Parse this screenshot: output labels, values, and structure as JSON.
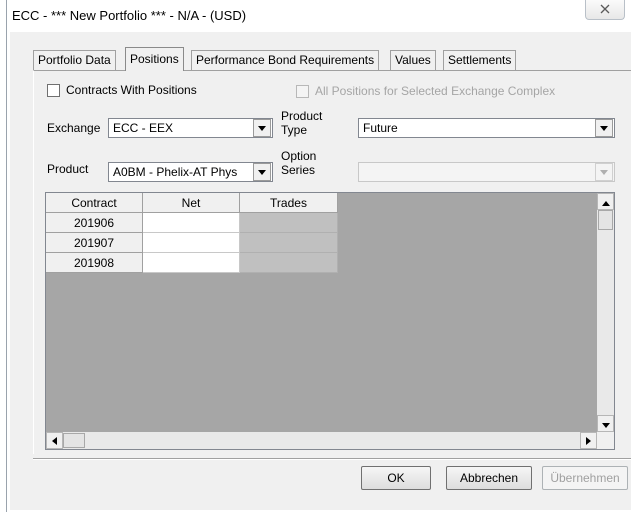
{
  "window": {
    "title": "ECC - *** New Portfolio *** - N/A - (USD)",
    "close_glyph": "✕"
  },
  "tabs": [
    {
      "label": "Portfolio Data",
      "active": false
    },
    {
      "label": "Positions",
      "active": true
    },
    {
      "label": "Performance Bond Requirements",
      "active": false
    },
    {
      "label": "Values",
      "active": false
    },
    {
      "label": "Settlements",
      "active": false
    }
  ],
  "filters": {
    "contracts_with_positions_label": "Contracts With Positions",
    "all_positions_label": "All Positions for Selected Exchange Complex",
    "exchange_label": "Exchange",
    "exchange_value": "ECC - EEX",
    "product_type_label_line1": "Product",
    "product_type_label_line2": "Type",
    "product_type_value": "Future",
    "product_label": "Product",
    "product_value": "A0BM - Phelix-AT Phys",
    "option_series_label_line1": "Option",
    "option_series_label_line2": "Series",
    "option_series_value": ""
  },
  "grid": {
    "headers": [
      "Contract",
      "Net",
      "Trades"
    ],
    "rows": [
      {
        "contract": "201906",
        "net": "",
        "trades": ""
      },
      {
        "contract": "201907",
        "net": "",
        "trades": ""
      },
      {
        "contract": "201908",
        "net": "",
        "trades": ""
      }
    ]
  },
  "buttons": {
    "ok": "OK",
    "cancel": "Abbrechen",
    "apply": "Übernehmen"
  },
  "icons": {
    "dropdown": "chevron-down-icon",
    "close": "close-icon",
    "scroll_up": "arrow-up-icon",
    "scroll_down": "arrow-down-icon",
    "scroll_left": "arrow-left-icon",
    "scroll_right": "arrow-right-icon"
  }
}
